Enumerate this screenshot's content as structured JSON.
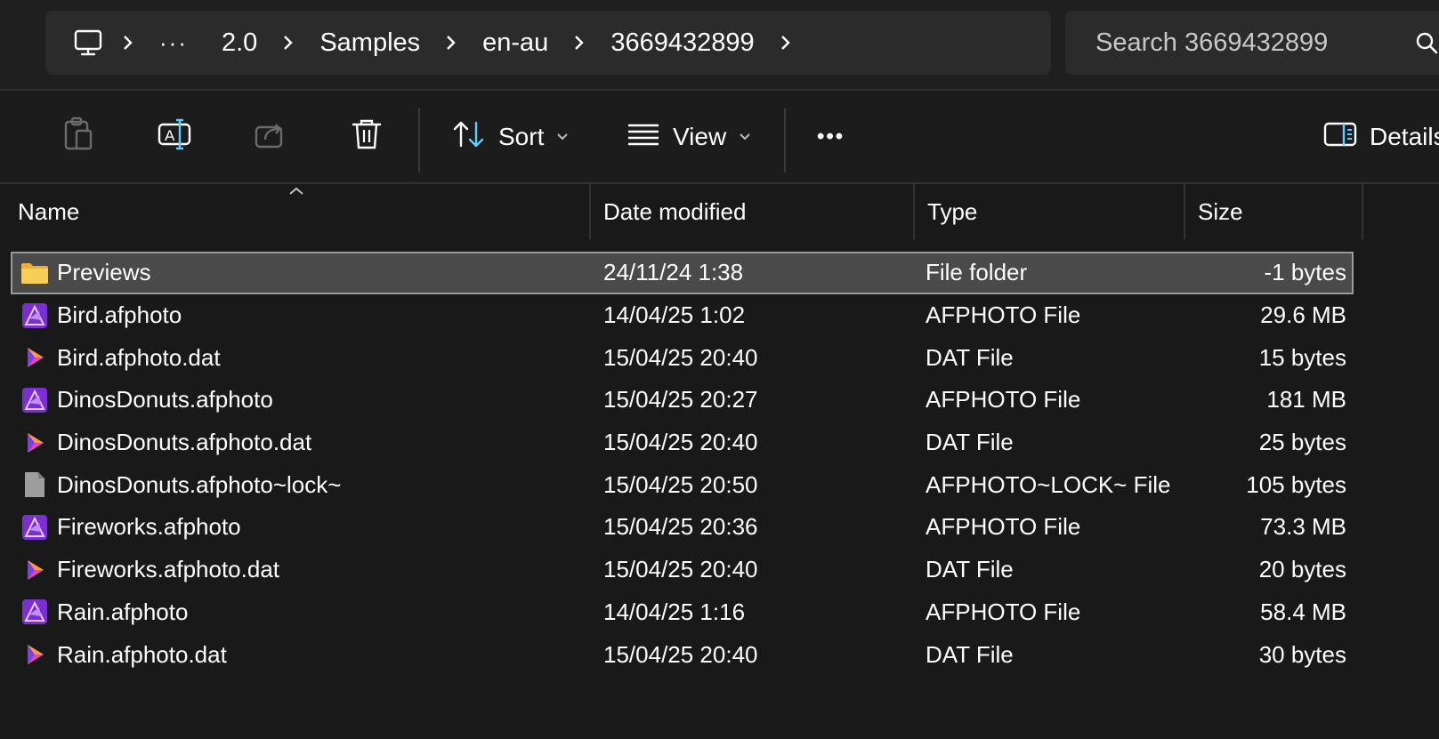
{
  "breadcrumb": {
    "root_icon": "computer-icon",
    "ellipsis": "···",
    "items": [
      "2.0",
      "Samples",
      "en-au",
      "3669432899"
    ]
  },
  "search": {
    "placeholder": "Search 3669432899"
  },
  "toolbar": {
    "sort_label": "Sort",
    "view_label": "View",
    "more_label": "•••",
    "details_label": "Details"
  },
  "columns": {
    "name": "Name",
    "date": "Date modified",
    "type": "Type",
    "size": "Size"
  },
  "files": [
    {
      "icon": "folder-icon",
      "name": "Previews",
      "date": "24/11/24 1:38",
      "type": "File folder",
      "size": "-1 bytes",
      "selected": true
    },
    {
      "icon": "affinity-photo-icon",
      "name": "Bird.afphoto",
      "date": "14/04/25 1:02",
      "type": "AFPHOTO File",
      "size": "29.6 MB"
    },
    {
      "icon": "dat-file-icon",
      "name": "Bird.afphoto.dat",
      "date": "15/04/25 20:40",
      "type": "DAT File",
      "size": "15 bytes"
    },
    {
      "icon": "affinity-photo-icon",
      "name": "DinosDonuts.afphoto",
      "date": "15/04/25 20:27",
      "type": "AFPHOTO File",
      "size": "181 MB"
    },
    {
      "icon": "dat-file-icon",
      "name": "DinosDonuts.afphoto.dat",
      "date": "15/04/25 20:40",
      "type": "DAT File",
      "size": "25 bytes"
    },
    {
      "icon": "generic-file-icon",
      "name": "DinosDonuts.afphoto~lock~",
      "date": "15/04/25 20:50",
      "type": "AFPHOTO~LOCK~ File",
      "size": "105 bytes"
    },
    {
      "icon": "affinity-photo-icon",
      "name": "Fireworks.afphoto",
      "date": "15/04/25 20:36",
      "type": "AFPHOTO File",
      "size": "73.3 MB"
    },
    {
      "icon": "dat-file-icon",
      "name": "Fireworks.afphoto.dat",
      "date": "15/04/25 20:40",
      "type": "DAT File",
      "size": "20 bytes"
    },
    {
      "icon": "affinity-photo-icon",
      "name": "Rain.afphoto",
      "date": "14/04/25 1:16",
      "type": "AFPHOTO File",
      "size": "58.4 MB"
    },
    {
      "icon": "dat-file-icon",
      "name": "Rain.afphoto.dat",
      "date": "15/04/25 20:40",
      "type": "DAT File",
      "size": "30 bytes"
    }
  ],
  "colors": {
    "background": "#191919",
    "panel": "#2b2b2b",
    "selection": "#4a4a4a",
    "folder": "#f4c542",
    "affinity_photo": "#b04cf0"
  }
}
